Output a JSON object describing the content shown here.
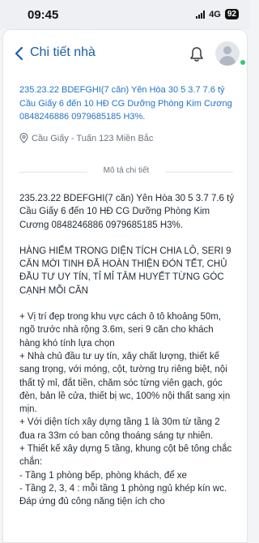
{
  "status_bar": {
    "time": "09:45",
    "network": "4G",
    "battery": "92"
  },
  "header": {
    "back_icon": "chevron-left-icon",
    "title": "Chi tiết nhà",
    "bell_icon": "bell-icon",
    "avatar_icon": "user-avatar-icon"
  },
  "listing": {
    "summary": "235.23.22 BDEFGHI(7 căn) Yên Hòa 30 5 3.7 7.6 tỷ Cầu Giấy 6 đến 10 HĐ CG Dưỡng Phòng Kim Cương 0848246886 0979685185 H3%.",
    "location": "Cầu Giấy - Tuấn 123 Miền Bắc"
  },
  "description": {
    "heading": "Mô tả chi tiết",
    "para1": "235.23.22 BDEFGHI(7 căn) Yên Hòa 30 5 3.7 7.6 tỷ Cầu Giấy 6 đến 10 HĐ CG Dưỡng Phòng Kim Cương 0848246886 0979685185 H3%.",
    "para2": "HÀNG HIẾM TRONG DIỆN TÍCH CHIA LÔ, SERI 9 CĂN MỚI TINH ĐÃ HOÀN THIỆN ĐÓN TẾT, CHỦ ĐẦU TƯ UY TÍN, TỈ MỈ TÂM HUYẾT TỪNG GÓC CẠNH MỖI CĂN",
    "bullet1": "+ Vị trí đẹp trong khu vực cách ô tô khoảng 50m, ngõ trước nhà rộng 3.6m, seri 9 căn cho khách hàng khó tính lựa chọn",
    "bullet2": "+ Nhà chủ đầu tư uy tín, xây chất lượng, thiết kế sang trọng, với móng, cột, tường trụ riêng biệt, nội thất tỷ mỉ, đắt tiền, chăm sóc từng viên gạch, góc đèn, bản lề cửa, thiết bị wc, 100% nội thất sang xịn mịn.",
    "bullet3": "+ Với diện tích xây dựng tầng 1 là 30m từ tầng 2 đua ra 33m có ban công thoáng sáng tự nhiên.",
    "bullet4": "+ Thiết kế xây dựng 5 tầng, khung cột bê tông chắc chắn:",
    "line5": "- Tầng 1 phòng bếp, phòng khách, để xe",
    "line6": "- Tầng 2, 3, 4 : mỗi tầng 1 phòng ngủ khép kín wc. Đáp ứng đủ công năng tiện ích cho"
  }
}
